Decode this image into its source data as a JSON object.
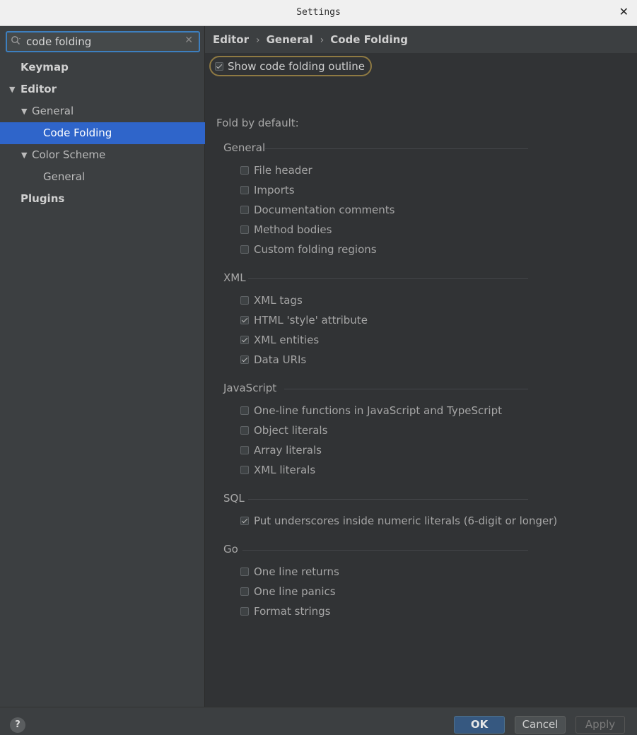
{
  "window": {
    "title": "Settings",
    "close_glyph": "✕"
  },
  "search": {
    "value": "code folding",
    "clear_glyph": "✕"
  },
  "tree": {
    "keymap": "Keymap",
    "editor": "Editor",
    "general": "General",
    "code_folding": "Code Folding",
    "color_scheme": "Color Scheme",
    "color_scheme_general": "General",
    "plugins": "Plugins"
  },
  "breadcrumb": {
    "items": [
      "Editor",
      "General",
      "Code Folding"
    ],
    "sep": "›"
  },
  "show_outline": {
    "label": "Show code folding outline",
    "checked": true
  },
  "fold_by_default": "Fold by default:",
  "groups": [
    {
      "title": "General",
      "options": [
        {
          "label": "File header",
          "checked": false
        },
        {
          "label": "Imports",
          "checked": false
        },
        {
          "label": "Documentation comments",
          "checked": false
        },
        {
          "label": "Method bodies",
          "checked": false
        },
        {
          "label": "Custom folding regions",
          "checked": false
        }
      ]
    },
    {
      "title": "XML",
      "options": [
        {
          "label": "XML tags",
          "checked": false
        },
        {
          "label": "HTML 'style' attribute",
          "checked": true
        },
        {
          "label": "XML entities",
          "checked": true
        },
        {
          "label": "Data URIs",
          "checked": true
        }
      ]
    },
    {
      "title": "JavaScript",
      "options": [
        {
          "label": "One-line functions in JavaScript and TypeScript",
          "checked": false
        },
        {
          "label": "Object literals",
          "checked": false
        },
        {
          "label": "Array literals",
          "checked": false
        },
        {
          "label": "XML literals",
          "checked": false
        }
      ]
    },
    {
      "title": "SQL",
      "options": [
        {
          "label": "Put underscores inside numeric literals (6-digit or longer)",
          "checked": true
        }
      ]
    },
    {
      "title": "Go",
      "options": [
        {
          "label": "One line returns",
          "checked": false
        },
        {
          "label": "One line panics",
          "checked": false
        },
        {
          "label": "Format strings",
          "checked": false
        }
      ]
    }
  ],
  "footer": {
    "help": "?",
    "ok": "OK",
    "cancel": "Cancel",
    "apply": "Apply"
  },
  "colors": {
    "accent": "#2f65ca",
    "focus": "#3d7fbf",
    "highlight_outline": "#8f7a43",
    "ok_button": "#365880"
  }
}
